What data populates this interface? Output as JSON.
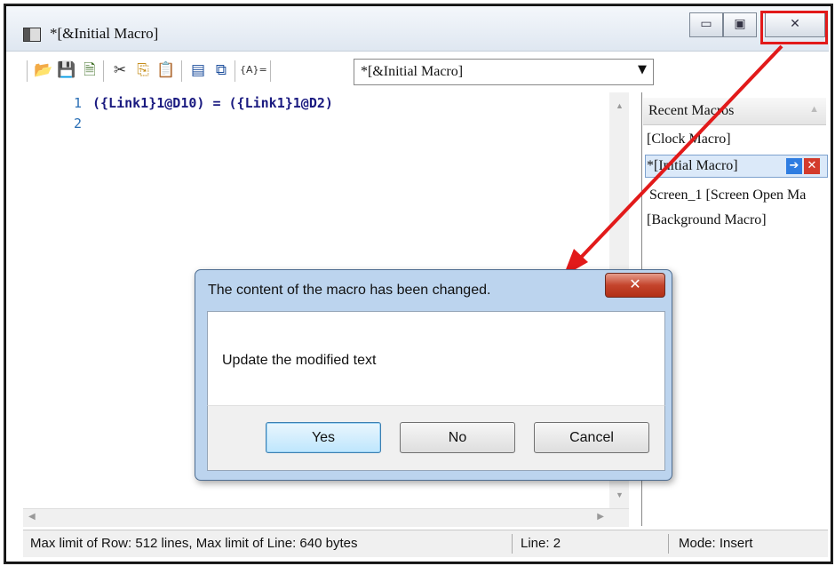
{
  "window": {
    "title": "*[&Initial Macro]",
    "minimize_glyph": "▭",
    "restore_glyph": "▣",
    "close_glyph": "✕"
  },
  "toolbar": {
    "icons": [
      "open-folder-icon",
      "save-icon",
      "export-icon",
      "cut-icon",
      "copy-icon",
      "paste-icon",
      "compile-icon",
      "properties-icon",
      "variable-icon"
    ],
    "variable_label": "{A}=",
    "macro_select": "*[&Initial Macro]"
  },
  "editor": {
    "lines": [
      {
        "number": "1",
        "code": "({Link1}1@D10) = ({Link1}1@D2)"
      },
      {
        "number": "2",
        "code": ""
      }
    ]
  },
  "recent_macros": {
    "header": "Recent Macros",
    "items": [
      "[Clock Macro]",
      "*[Initial Macro]",
      "Screen_1 [Screen Open Ma",
      "[Background Macro]"
    ],
    "selected_index": 1
  },
  "status": {
    "limits": "Max limit of Row: 512 lines, Max limit of Line: 640 bytes",
    "line": "Line: 2",
    "mode": "Mode: Insert"
  },
  "dialog": {
    "title": "The content of the macro has been changed.",
    "message": "Update the modified text",
    "close_glyph": "✕",
    "buttons": {
      "yes": "Yes",
      "no": "No",
      "cancel": "Cancel"
    }
  },
  "colors": {
    "annotation_red": "#e21a1a",
    "code_blue": "#1a1a80",
    "code_red": "#d0341e",
    "dialog_frame": "#bcd4ee"
  }
}
